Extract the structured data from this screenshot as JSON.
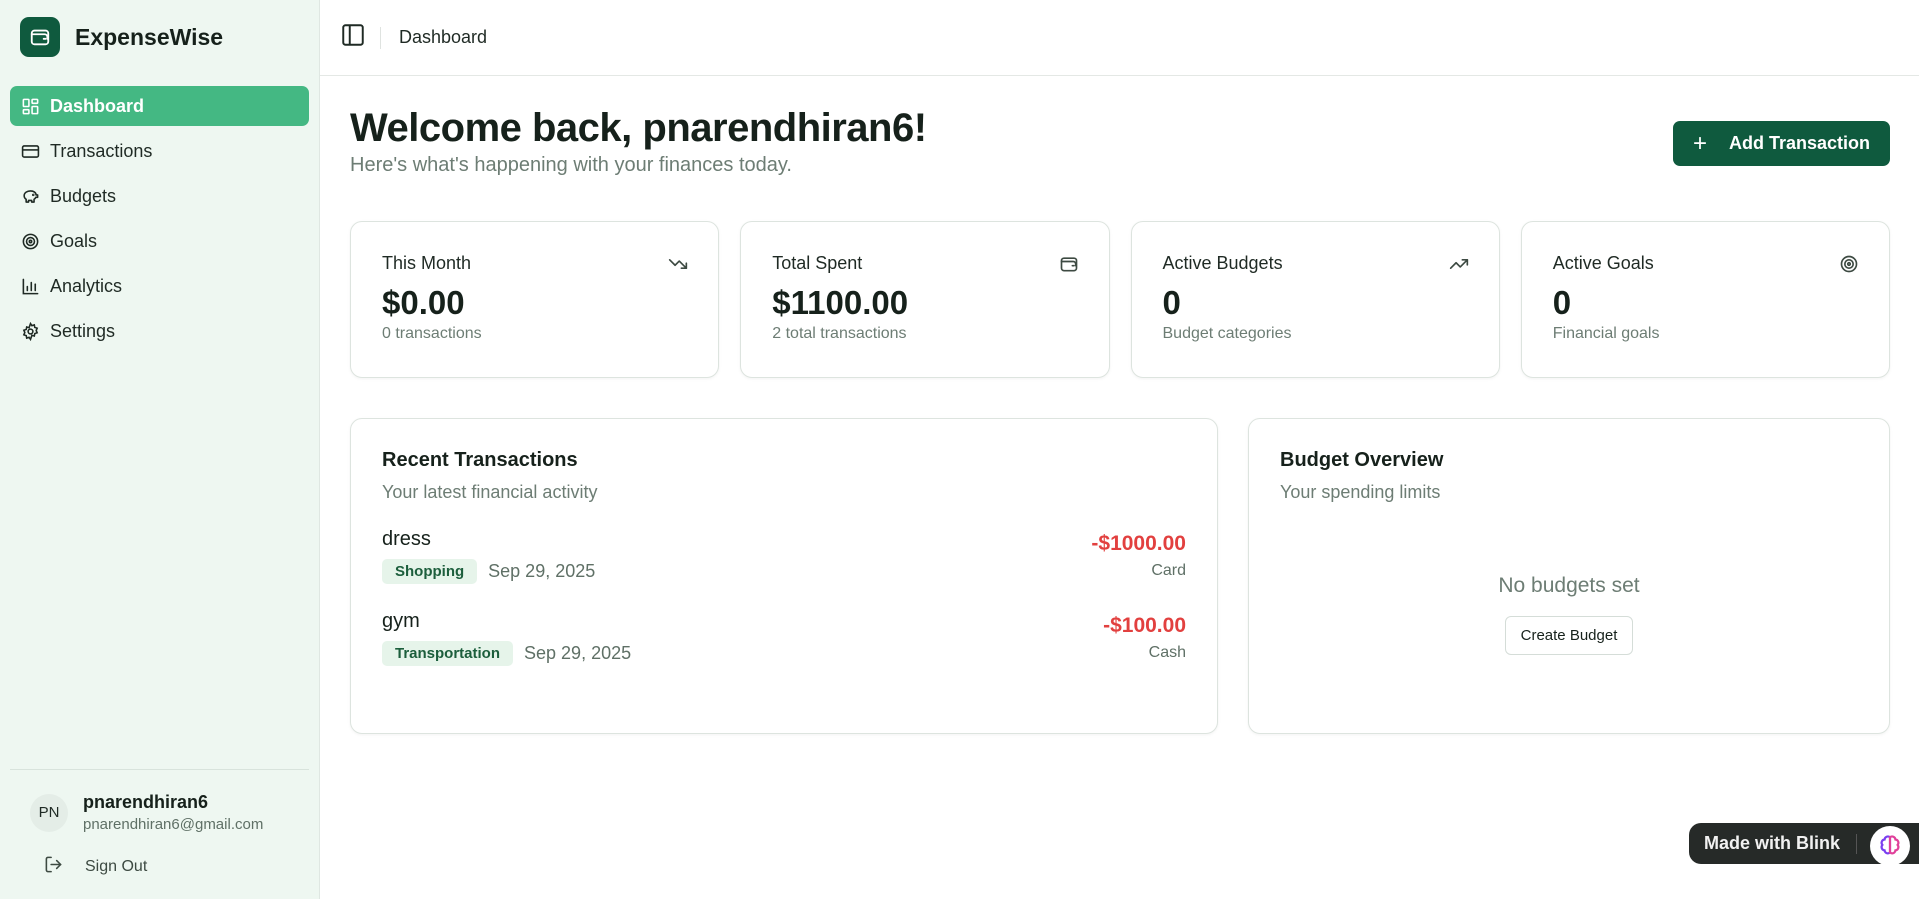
{
  "app": {
    "name": "ExpenseWise"
  },
  "sidebar": {
    "items": [
      {
        "label": "Dashboard",
        "icon": "dashboard-icon",
        "active": true
      },
      {
        "label": "Transactions",
        "icon": "credit-card-icon"
      },
      {
        "label": "Budgets",
        "icon": "piggy-bank-icon"
      },
      {
        "label": "Goals",
        "icon": "target-icon"
      },
      {
        "label": "Analytics",
        "icon": "bar-chart-icon"
      },
      {
        "label": "Settings",
        "icon": "gear-icon"
      }
    ],
    "user": {
      "initials": "PN",
      "name": "pnarendhiran6",
      "email": "pnarendhiran6@gmail.com"
    },
    "sign_out_label": "Sign Out"
  },
  "topbar": {
    "breadcrumb": "Dashboard"
  },
  "welcome": {
    "title": "Welcome back, pnarendhiran6!",
    "subtitle": "Here's what's happening with your finances today.",
    "add_button_label": "Add Transaction"
  },
  "stats": [
    {
      "title": "This Month",
      "value": "$0.00",
      "sub": "0 transactions",
      "icon": "trending-down-icon"
    },
    {
      "title": "Total Spent",
      "value": "$1100.00",
      "sub": "2 total transactions",
      "icon": "wallet-icon"
    },
    {
      "title": "Active Budgets",
      "value": "0",
      "sub": "Budget categories",
      "icon": "trending-up-icon"
    },
    {
      "title": "Active Goals",
      "value": "0",
      "sub": "Financial goals",
      "icon": "target-icon"
    }
  ],
  "recent": {
    "title": "Recent Transactions",
    "subtitle": "Your latest financial activity",
    "transactions": [
      {
        "name": "dress",
        "category": "Shopping",
        "date": "Sep 29, 2025",
        "amount": "-$1000.00",
        "method": "Card"
      },
      {
        "name": "gym",
        "category": "Transportation",
        "date": "Sep 29, 2025",
        "amount": "-$100.00",
        "method": "Cash"
      }
    ]
  },
  "budget_overview": {
    "title": "Budget Overview",
    "subtitle": "Your spending limits",
    "empty_text": "No budgets set",
    "create_label": "Create Budget"
  },
  "badge": {
    "label": "Made with Blink"
  },
  "colors": {
    "brand": "#0f5a3e",
    "active_nav": "#44b883",
    "negative": "#e2403f",
    "badge_bg": "#e6f4ea"
  }
}
